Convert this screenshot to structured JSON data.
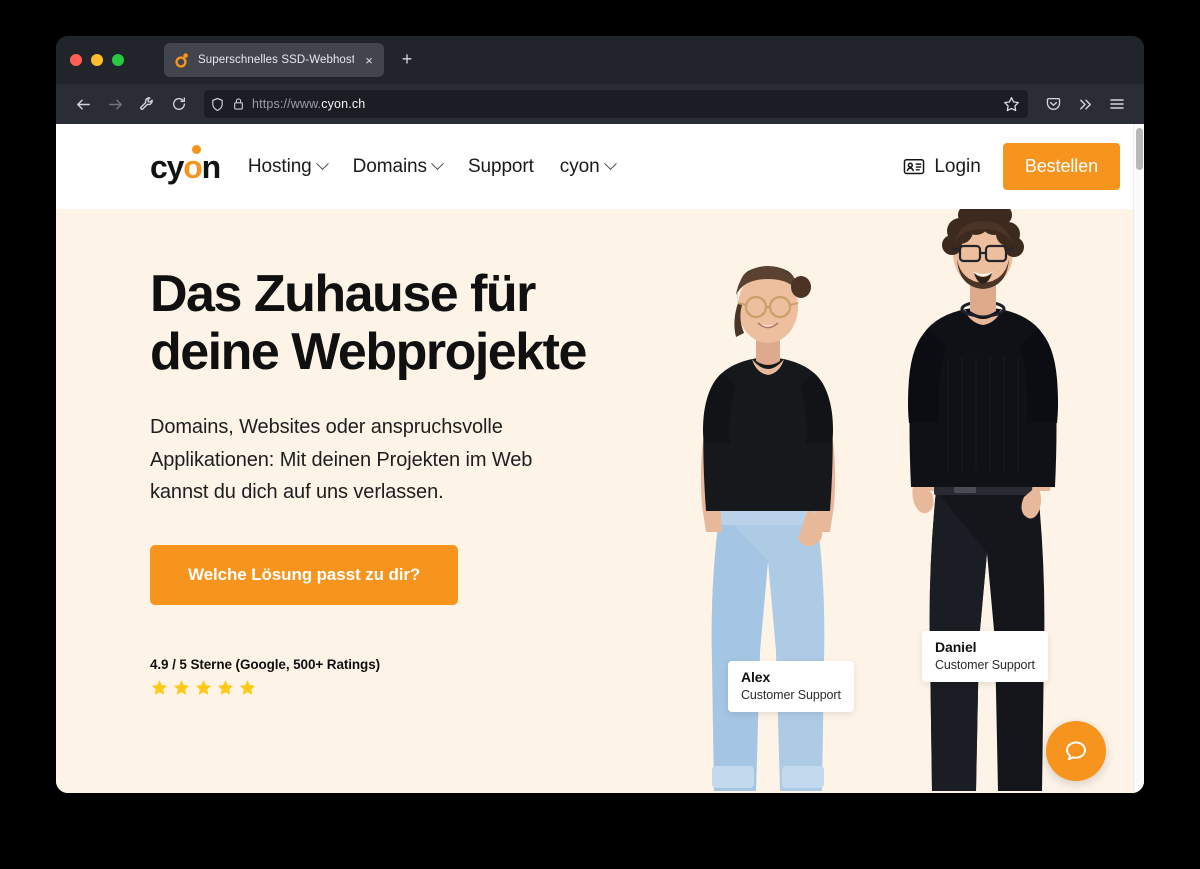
{
  "browser": {
    "traffic_lights": [
      "close",
      "minimize",
      "maximize"
    ],
    "tab": {
      "title": "Superschnelles SSD-Webhosting",
      "favicon": "cyon-logo-icon",
      "close_label": "×"
    },
    "new_tab_label": "+",
    "toolbar": {
      "back_icon": "back-arrow-icon",
      "forward_icon": "forward-arrow-icon",
      "tools_icon": "wrench-icon",
      "reload_icon": "reload-icon",
      "shield_icon": "shield-icon",
      "lock_icon": "padlock-icon",
      "url_prefix": "https://www.",
      "url_host": "cyon.ch",
      "url_full": "https://www.cyon.ch",
      "bookmark_icon": "star-icon",
      "pocket_icon": "pocket-icon",
      "overflow_label": "»",
      "menu_icon": "hamburger-menu-icon"
    }
  },
  "site": {
    "logo": {
      "part1": "cy",
      "part2": "o",
      "part3": "n",
      "alt": "cyon"
    },
    "nav": [
      {
        "label": "Hosting",
        "has_dropdown": true
      },
      {
        "label": "Domains",
        "has_dropdown": true
      },
      {
        "label": "Support",
        "has_dropdown": false
      },
      {
        "label": "cyon",
        "has_dropdown": true
      }
    ],
    "login": {
      "label": "Login",
      "icon": "id-card-icon"
    },
    "order_button": "Bestellen",
    "hero": {
      "title": "Das Zuhause für deine Webprojekte",
      "subtitle": "Domains, Websites oder anspruchsvolle Applikationen: Mit deinen Projekten im Web kannst du dich auf uns verlassen.",
      "cta": "Welche Lösung passt zu dir?",
      "rating_text": "4.9 / 5 Sterne (Google, 500+ Ratings)",
      "stars_filled": 5,
      "badges": [
        {
          "name": "Alex",
          "role": "Customer Support"
        },
        {
          "name": "Daniel",
          "role": "Customer Support"
        }
      ]
    },
    "chat_beacon": {
      "icon": "chat-bubble-icon",
      "label": "Support Chat"
    }
  },
  "colors": {
    "brand_orange": "#f7941e",
    "hero_background": "#fdf3e7",
    "star_yellow": "#ffc91a",
    "chrome_dark": "#22242c",
    "text_dark": "#101010"
  }
}
